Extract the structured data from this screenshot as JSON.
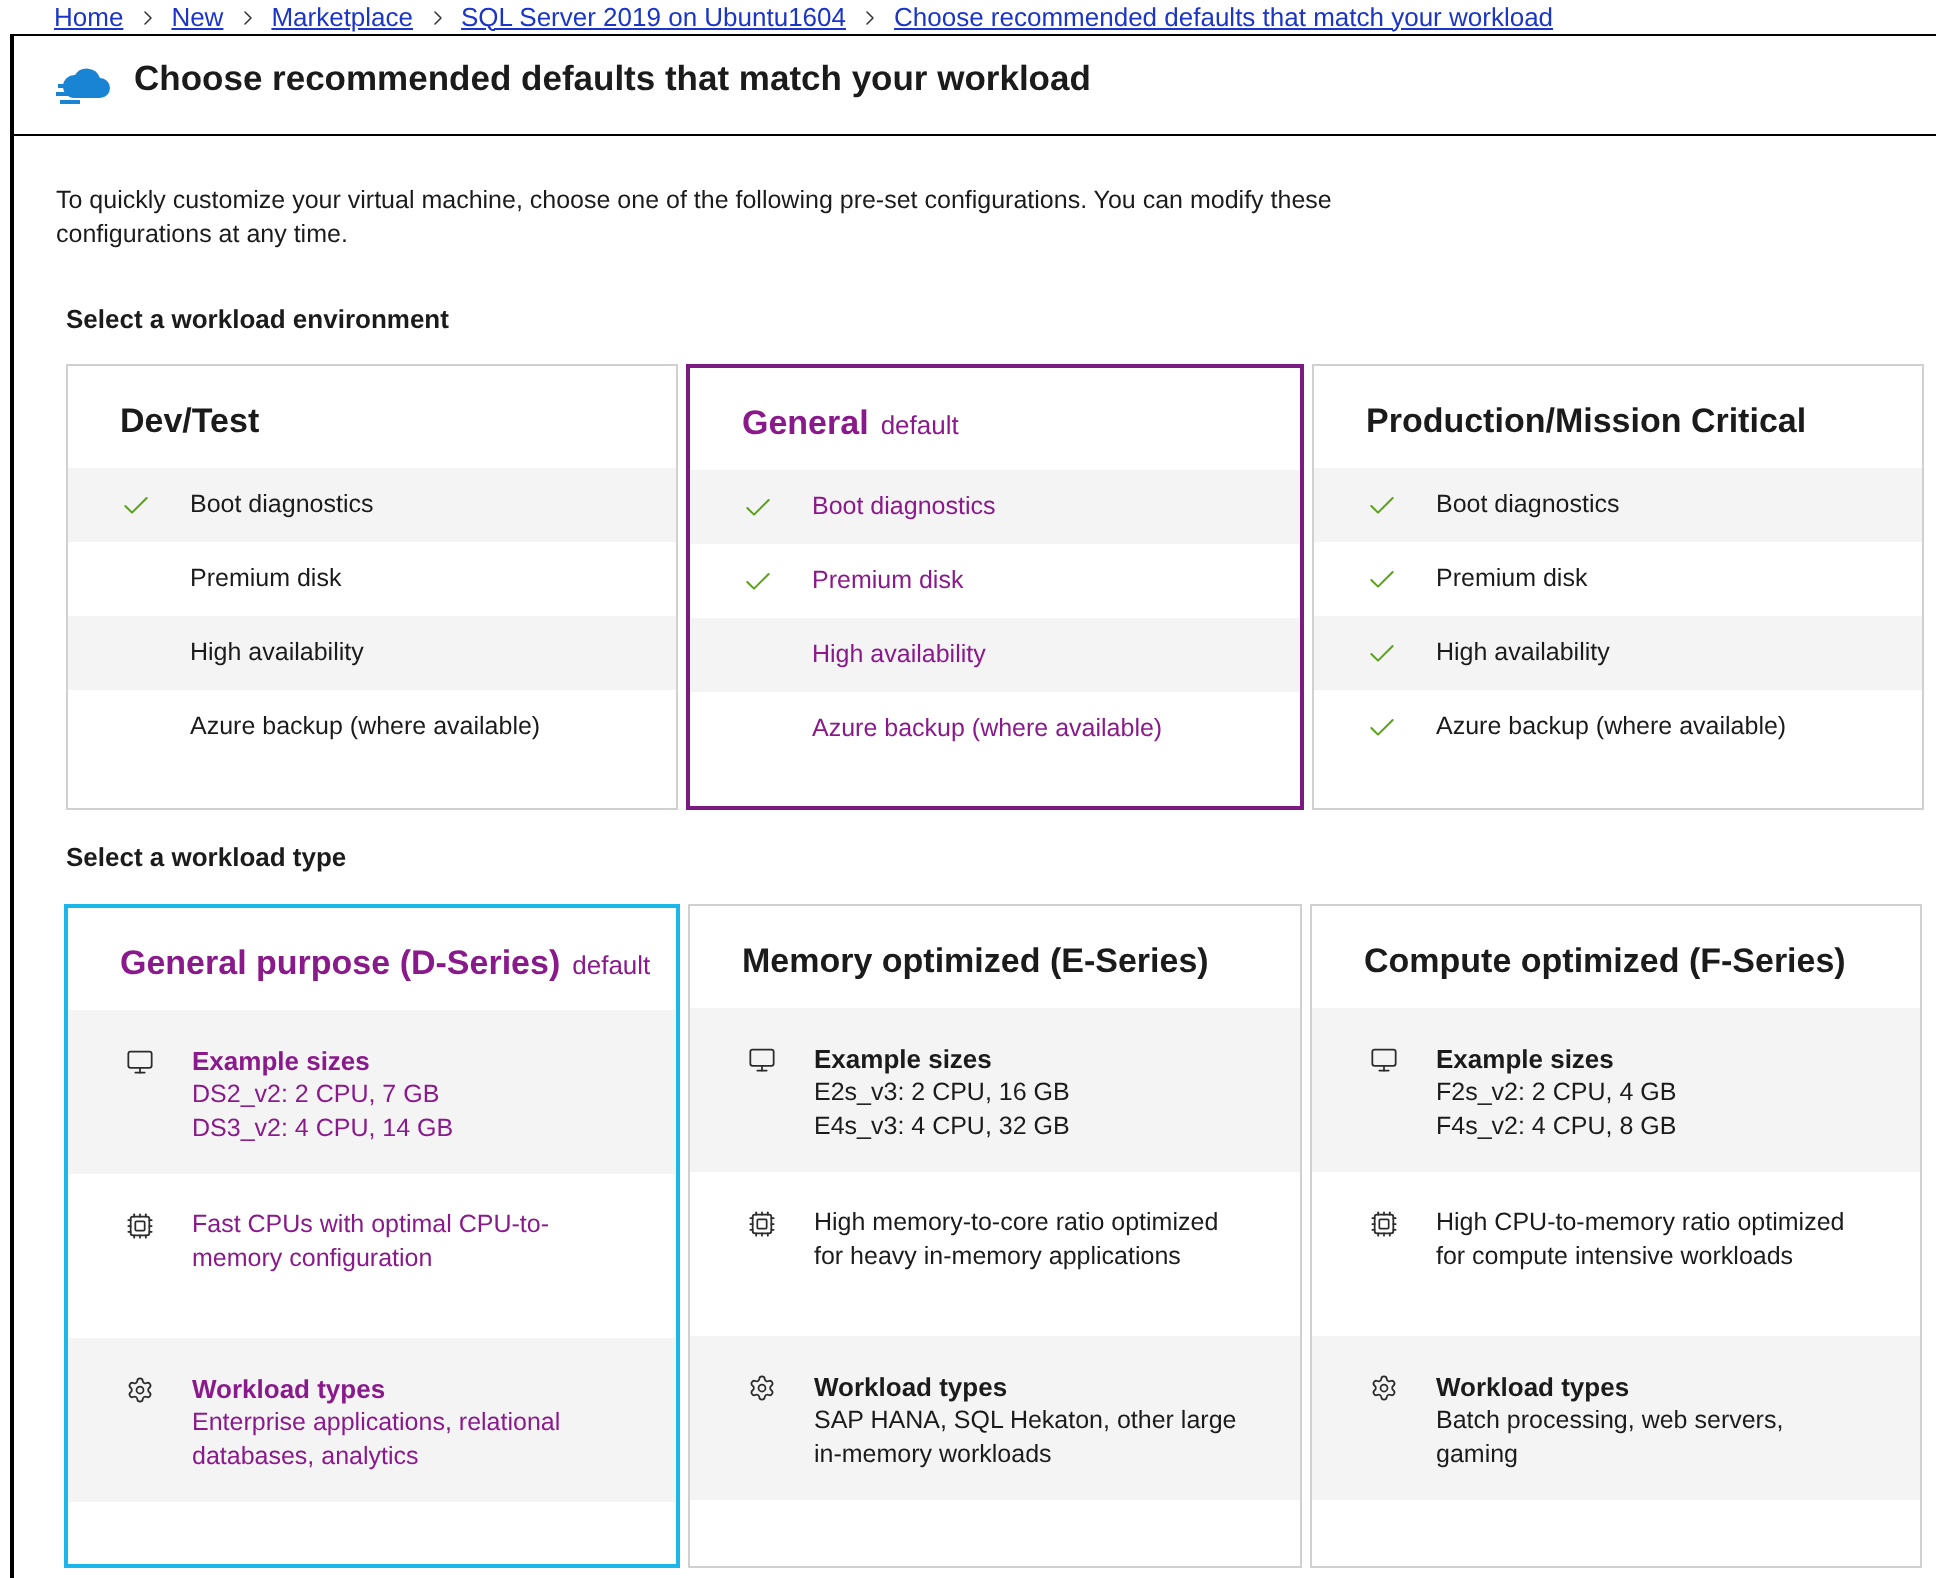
{
  "breadcrumb": [
    "Home",
    "New",
    "Marketplace",
    "SQL Server 2019 on Ubuntu1604",
    "Choose recommended defaults that match your workload"
  ],
  "header": {
    "title": "Choose recommended defaults that match your workload"
  },
  "intro": "To quickly customize your virtual machine, choose one of the following pre-set configurations. You can modify these configurations at any time.",
  "environment": {
    "label": "Select a workload environment",
    "options": [
      {
        "title": "Dev/Test",
        "selected": false,
        "features": [
          {
            "label": "Boot diagnostics",
            "checked": true
          },
          {
            "label": "Premium disk",
            "checked": false
          },
          {
            "label": "High availability",
            "checked": false
          },
          {
            "label": "Azure backup (where available)",
            "checked": false
          }
        ]
      },
      {
        "title": "General",
        "badge": "default",
        "selected": true,
        "features": [
          {
            "label": "Boot diagnostics",
            "checked": true
          },
          {
            "label": "Premium disk",
            "checked": true
          },
          {
            "label": "High availability",
            "checked": false
          },
          {
            "label": "Azure backup (where available)",
            "checked": false
          }
        ]
      },
      {
        "title": "Production/Mission Critical",
        "selected": false,
        "features": [
          {
            "label": "Boot diagnostics",
            "checked": true
          },
          {
            "label": "Premium disk",
            "checked": true
          },
          {
            "label": "High availability",
            "checked": true
          },
          {
            "label": "Azure backup (where available)",
            "checked": true
          }
        ]
      }
    ]
  },
  "workload_type": {
    "label": "Select a workload type",
    "options": [
      {
        "title": "General purpose (D-Series)",
        "badge": "default",
        "selected": true,
        "focused": true,
        "sections": [
          {
            "kind": "sizes",
            "heading": "Example sizes",
            "lines": [
              "DS2_v2: 2 CPU, 7 GB",
              "DS3_v2: 4 CPU, 14 GB"
            ]
          },
          {
            "kind": "processor",
            "text": "Fast CPUs with optimal CPU-to-memory configuration"
          },
          {
            "kind": "workloads",
            "heading": "Workload types",
            "text": "Enterprise applications, relational databases, analytics"
          }
        ]
      },
      {
        "title": "Memory optimized (E-Series)",
        "selected": false,
        "focused": false,
        "sections": [
          {
            "kind": "sizes",
            "heading": "Example sizes",
            "lines": [
              "E2s_v3: 2 CPU, 16 GB",
              "E4s_v3: 4 CPU, 32 GB"
            ]
          },
          {
            "kind": "processor",
            "text": "High memory-to-core ratio optimized for heavy in-memory applications"
          },
          {
            "kind": "workloads",
            "heading": "Workload types",
            "text": "SAP HANA, SQL Hekaton, other large in-memory workloads"
          }
        ]
      },
      {
        "title": "Compute optimized (F-Series)",
        "selected": false,
        "focused": false,
        "sections": [
          {
            "kind": "sizes",
            "heading": "Example sizes",
            "lines": [
              "F2s_v2: 2 CPU, 4 GB",
              "F4s_v2: 4 CPU, 8 GB"
            ]
          },
          {
            "kind": "processor",
            "text": "High CPU-to-memory ratio optimized for compute intensive workloads"
          },
          {
            "kind": "workloads",
            "heading": "Workload types",
            "text": "Batch processing, web servers, gaming"
          }
        ]
      }
    ]
  }
}
